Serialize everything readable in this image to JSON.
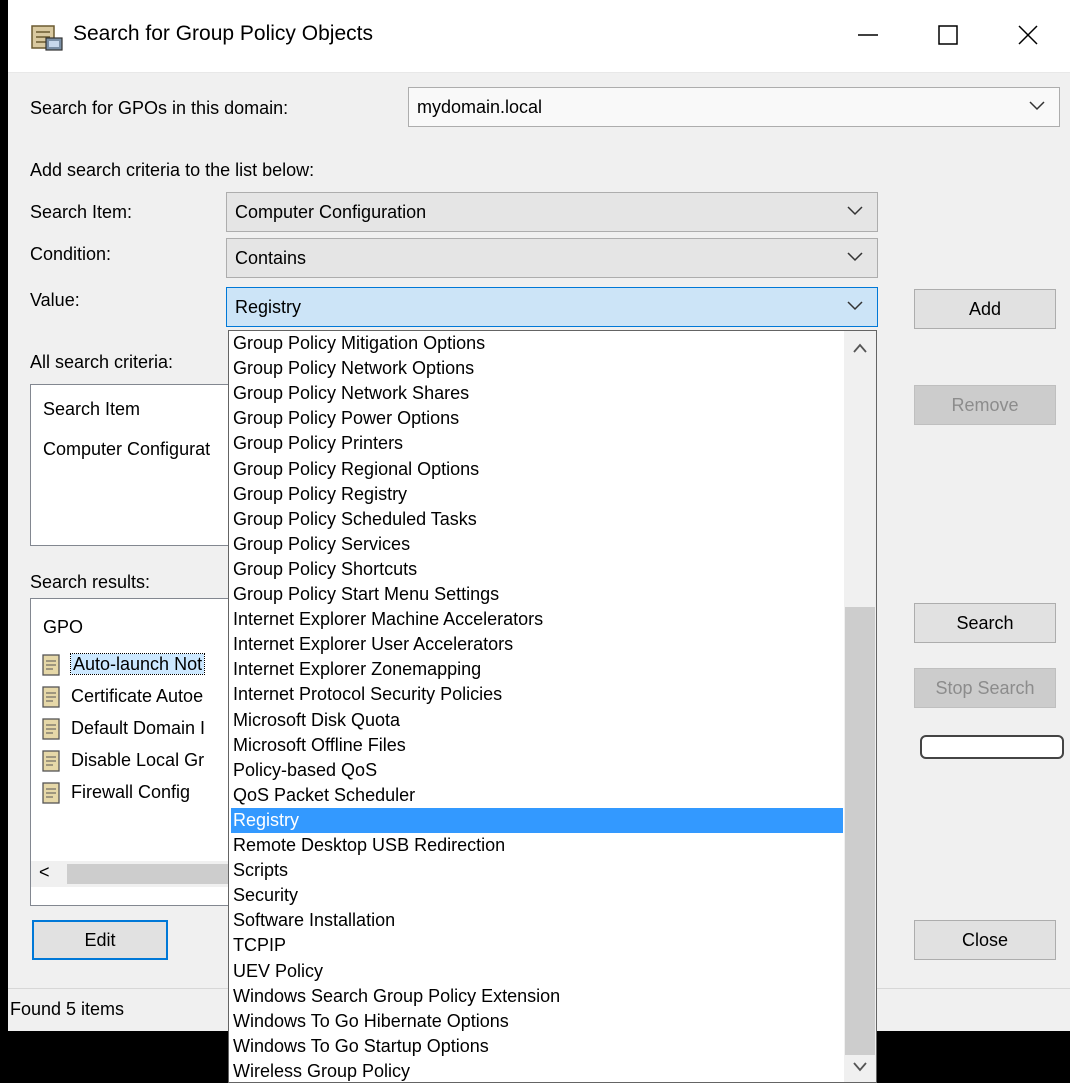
{
  "window": {
    "title": "Search for Group Policy Objects",
    "minimize": "—",
    "maximize": "☐",
    "close": "✕"
  },
  "domain": {
    "label": "Search for GPOs in this domain:",
    "value": "mydomain.local"
  },
  "criteria": {
    "heading": "Add search criteria to the list below:",
    "search_item_label": "Search Item:",
    "search_item_value": "Computer Configuration",
    "condition_label": "Condition:",
    "condition_value": "Contains",
    "value_label": "Value:",
    "value_value": "Registry"
  },
  "buttons": {
    "add": "Add",
    "remove": "Remove",
    "search": "Search",
    "stop_search": "Stop Search",
    "edit": "Edit",
    "close": "Close"
  },
  "all_criteria": {
    "label": "All search criteria:",
    "header": "Search Item",
    "rows": [
      "Computer Configurat"
    ]
  },
  "results": {
    "label": "Search results:",
    "header": "GPO",
    "rows": [
      "Auto-launch Not",
      "Certificate Autoe",
      "Default Domain I",
      "Disable Local Gr",
      "Firewall Config"
    ],
    "scroll_left": "<"
  },
  "status": {
    "text": "Found 5 items"
  },
  "dropdown": {
    "selected_index": 19,
    "items": [
      "Group Policy Mitigation Options",
      "Group Policy Network Options",
      "Group Policy Network Shares",
      "Group Policy Power Options",
      "Group Policy Printers",
      "Group Policy Regional Options",
      "Group Policy Registry",
      "Group Policy Scheduled Tasks",
      "Group Policy Services",
      "Group Policy Shortcuts",
      "Group Policy Start Menu Settings",
      "Internet Explorer Machine Accelerators",
      "Internet Explorer User Accelerators",
      "Internet Explorer Zonemapping",
      "Internet Protocol Security Policies",
      "Microsoft Disk Quota",
      "Microsoft Offline Files",
      "Policy-based QoS",
      "QoS Packet Scheduler",
      "Registry",
      "Remote Desktop USB Redirection",
      "Scripts",
      "Security",
      "Software Installation",
      "TCPIP",
      "UEV Policy",
      "Windows Search Group Policy Extension",
      "Windows To Go Hibernate Options",
      "Windows To Go Startup Options",
      "Wireless Group Policy"
    ]
  },
  "colors": {
    "accent": "#0078d7",
    "selection": "#3399ff"
  }
}
